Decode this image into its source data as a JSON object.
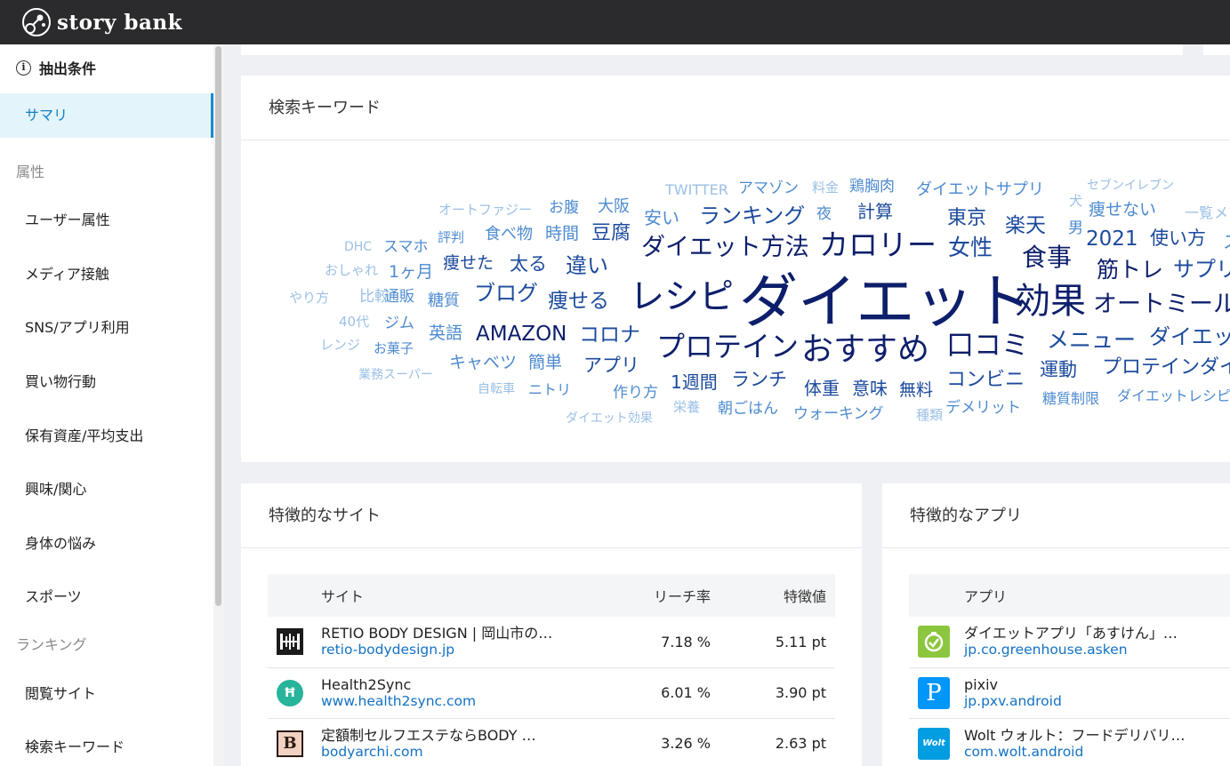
{
  "app": {
    "logo_text": "story bank"
  },
  "sidebar": {
    "header": "抽出条件",
    "active_item": "サマリ",
    "section_attr": "属性",
    "attr_items": [
      "ユーザー属性",
      "メディア接触",
      "SNS/アプリ利用",
      "買い物行動",
      "保有資産/平均支出",
      "興味/関心",
      "身体の悩み",
      "スポーツ"
    ],
    "section_rank": "ランキング",
    "rank_items": [
      "閲覧サイト",
      "検索キーワード"
    ]
  },
  "keywords": {
    "title": "検索キーワード",
    "words": [
      "ダイエット",
      "レシピ",
      "効果",
      "おすすめ",
      "プロテイン",
      "カロリー",
      "口コミ",
      "ダイエット方法",
      "オートミール",
      "食事",
      "AMAZON",
      "筋トレ",
      "メニュー",
      "女性",
      "ランキング",
      "コロナ",
      "ブログ",
      "痩せる",
      "違い",
      "サプリ",
      "ダイエッ",
      "プロテインダイ",
      "楽天",
      "東京",
      "コンビニ",
      "2021",
      "太る",
      "豆腐",
      "痩せた",
      "使い方",
      "アプリ",
      "運動",
      "ランチ",
      "1週間",
      "体重",
      "意味",
      "無料",
      "簡単",
      "キャベツ",
      "計算",
      "時間",
      "食べ物",
      "英語",
      "糖質",
      "通販",
      "比較",
      "ジム",
      "スマホ",
      "1ヶ月",
      "安い",
      "大阪",
      "お腹",
      "夜",
      "痩せない",
      "ダイエットサプリ",
      "鶏胸肉",
      "デメリット",
      "ウォーキング",
      "朝ごはん",
      "作り方",
      "ニトリ",
      "糖質制限",
      "ダイエットレシピ",
      "TWITTER",
      "アマゾン",
      "料金",
      "セブンイレブン",
      "一覧",
      "メ",
      "男",
      "犬",
      "ス",
      "評判",
      "オートファジー",
      "DHC",
      "おしゃれ",
      "やり方",
      "40代",
      "レンジ",
      "お菓子",
      "業務スーパー",
      "自転車",
      "栄養",
      "種類",
      "ダイエット効果"
    ]
  },
  "sites": {
    "title": "特徴的なサイト",
    "col_site": "サイト",
    "col_reach": "リーチ率",
    "col_feature": "特徴値",
    "rows": [
      {
        "icon": "retio-logo-icon",
        "name": "RETIO BODY DESIGN | 岡山市の…",
        "url": "retio-bodydesign.jp",
        "reach": "7.18 %",
        "feature": "5.11 pt"
      },
      {
        "icon": "health2sync-logo-icon",
        "name": "Health2Sync",
        "url": "www.health2sync.com",
        "reach": "6.01 %",
        "feature": "3.90 pt"
      },
      {
        "icon": "bodyarchi-logo-icon",
        "name": "定額制セルフエステならBODY …",
        "url": "bodyarchi.com",
        "reach": "3.26 %",
        "feature": "2.63 pt"
      }
    ]
  },
  "apps": {
    "title": "特徴的なアプリ",
    "col_app": "アプリ",
    "rows": [
      {
        "icon": "asken-logo-icon",
        "name": "ダイエットアプリ「あすけん」…",
        "url": "jp.co.greenhouse.asken"
      },
      {
        "icon": "pixiv-logo-icon",
        "name": "pixiv",
        "url": "jp.pxv.android"
      },
      {
        "icon": "wolt-logo-icon",
        "icon_text": "Wolt",
        "name": "Wolt ウォルト：フードデリバリ…",
        "url": "com.wolt.android"
      }
    ]
  },
  "colors": {
    "topbar": "#2b2b2d",
    "accent": "#1e88d2",
    "word_dark": "#0d1f6b",
    "word_mid": "#1b4a9c",
    "word_light": "#4d8bd0",
    "word_pale": "#9bc0e6"
  }
}
